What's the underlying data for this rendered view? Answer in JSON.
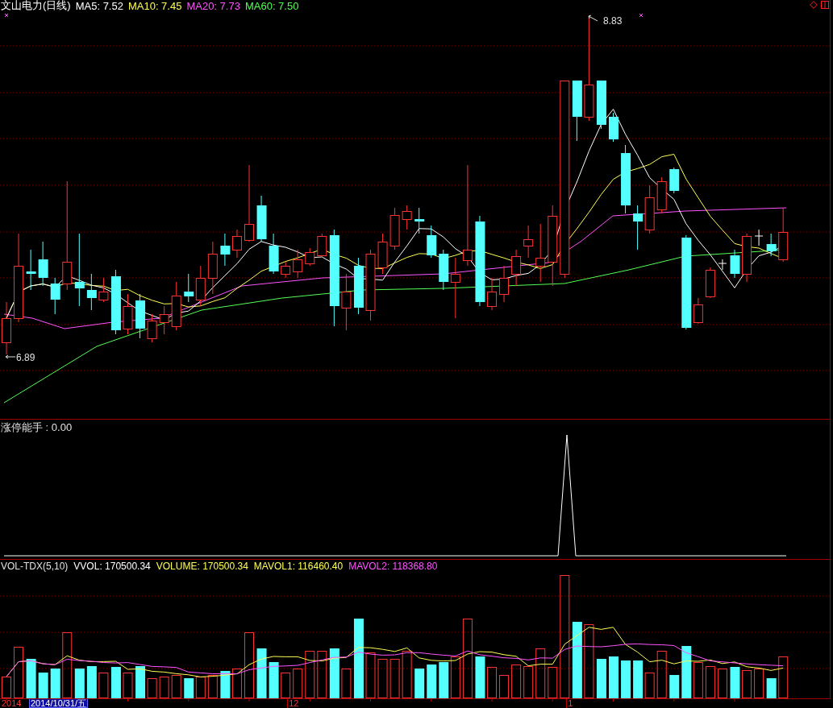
{
  "title": "文山电力(日线)",
  "moving_averages": [
    {
      "label": "MA5: 7.52",
      "color": "#ffffff"
    },
    {
      "label": "MA10: 7.45",
      "color": "#ffff54"
    },
    {
      "label": "MA20: 7.73",
      "color": "#ff54ff"
    },
    {
      "label": "MA60: 7.50",
      "color": "#54ff54"
    }
  ],
  "price_labels": {
    "high": "8.83",
    "low": "6.89"
  },
  "indicator": {
    "label": "涨停能手 : 0.00"
  },
  "volume_readings": [
    {
      "label": "VOL-TDX(5,10)",
      "color": "#e0e0e0"
    },
    {
      "label": "VVOL: 170500.34",
      "color": "#ffffff"
    },
    {
      "label": "VOLUME: 170500.34",
      "color": "#ffff54"
    },
    {
      "label": "MAVOL1: 116460.40",
      "color": "#ffff54"
    },
    {
      "label": "MAVOL2: 118368.80",
      "color": "#ff54ff"
    }
  ],
  "date_axis": {
    "year": "2014",
    "cursor_date": "2014/10/31/五",
    "months": [
      "12",
      "1"
    ]
  }
}
